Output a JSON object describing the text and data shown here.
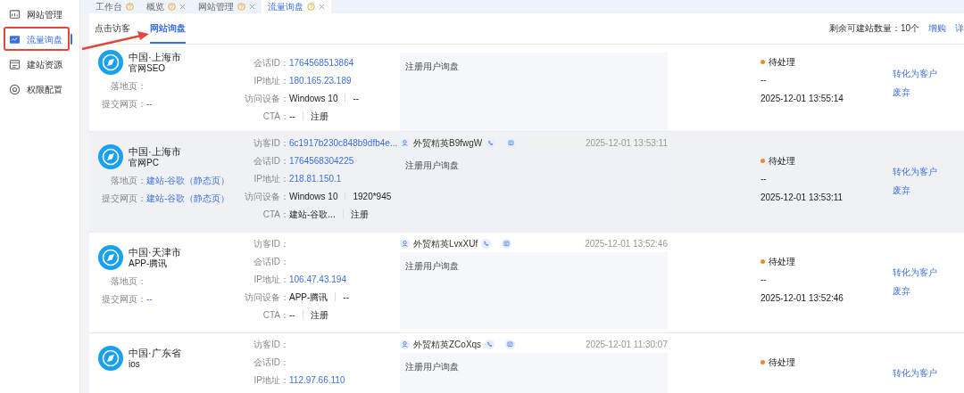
{
  "sidebar": {
    "items": [
      {
        "label": "网站管理",
        "selected": false
      },
      {
        "label": "流量询盘",
        "selected": true
      },
      {
        "label": "建站资源",
        "selected": false
      },
      {
        "label": "权限配置",
        "selected": false
      }
    ]
  },
  "tabs": [
    {
      "label": "工作台",
      "closable": false,
      "selected": false
    },
    {
      "label": "概览",
      "closable": true,
      "selected": false
    },
    {
      "label": "网站管理",
      "closable": true,
      "selected": false
    },
    {
      "label": "流量询盘",
      "closable": true,
      "selected": true
    }
  ],
  "subtabs": [
    {
      "label": "点击访客",
      "selected": false
    },
    {
      "label": "网站询盘",
      "selected": true
    }
  ],
  "quota": {
    "label": "剩余可建站数量：",
    "value": "10个",
    "links": [
      "增购",
      "详"
    ]
  },
  "rows": [
    {
      "highlighted": false,
      "location": "中国·上海市",
      "channel": "官网SEO",
      "landing": {
        "label": "落地页："
      },
      "submit": {
        "label": "提交网页：",
        "value": "--"
      },
      "info": [
        {
          "label": "会话ID：",
          "values": [
            "1764568513864"
          ],
          "link": true
        },
        {
          "label": "IP地址：",
          "values": [
            "180.165.23.189"
          ],
          "link": true
        },
        {
          "label": "访问设备：",
          "values": [
            "Windows 10",
            "--"
          ],
          "link": false
        },
        {
          "label": "CTA：",
          "values": [
            "--",
            "注册"
          ],
          "link": false
        }
      ],
      "message": "注册用户询盘",
      "status": {
        "label": "待处理",
        "color": "#f0892e"
      },
      "handler": "--",
      "handled_at": "2025-12-01 13:55:14",
      "actions": [
        "转化为客户",
        "废弃"
      ]
    },
    {
      "highlighted": true,
      "location": "中国·上海市",
      "channel": "官网PC",
      "landing": {
        "label": "落地页：",
        "value": "建站-谷歌（静态页）"
      },
      "submit": {
        "label": "提交网页：",
        "value": "建站-谷歌（静态页）"
      },
      "info": [
        {
          "label": "访客ID：",
          "values": [
            "6c1917b230c848b9dfb4e..."
          ],
          "link": true
        },
        {
          "label": "会话ID：",
          "values": [
            "1764568304225"
          ],
          "link": true
        },
        {
          "label": "IP地址：",
          "values": [
            "218.81.150.1"
          ],
          "link": true
        },
        {
          "label": "访问设备：",
          "values": [
            "Windows 10",
            "1920*945"
          ],
          "link": false
        },
        {
          "label": "CTA：",
          "values": [
            "建站-谷歌...",
            "注册"
          ],
          "link": false
        }
      ],
      "agent": "外贸精英B9fwgW",
      "time": "2025-12-01 13:53:11",
      "message": "注册用户询盘",
      "status": {
        "label": "待处理",
        "color": "#f0892e"
      },
      "handler": "--",
      "handled_at": "2025-12-01 13:53:11",
      "actions": [
        "转化为客户",
        "废弃"
      ]
    },
    {
      "highlighted": false,
      "location": "中国·天津市",
      "channel": "APP-腾讯",
      "landing": {
        "label": "落地页："
      },
      "submit": {
        "label": "提交网页：",
        "value": "--"
      },
      "info": [
        {
          "label": "访客ID："
        },
        {
          "label": "会话ID："
        },
        {
          "label": "IP地址：",
          "values": [
            "106.47.43.194"
          ],
          "link": true
        },
        {
          "label": "访问设备：",
          "values": [
            "APP-腾讯",
            "--"
          ],
          "link": false
        },
        {
          "label": "CTA：",
          "values": [
            "--",
            "注册"
          ],
          "link": false
        }
      ],
      "agent": "外贸精英LvxXUf",
      "time": "2025-12-01 13:52:46",
      "message": "注册用户询盘",
      "status": {
        "label": "待处理",
        "color": "#f0892e"
      },
      "handler": "--",
      "handled_at": "2025-12-01 13:52:46",
      "actions": [
        "转化为客户",
        "废弃"
      ]
    },
    {
      "highlighted": false,
      "location": "中国·广东省",
      "channel": "ios",
      "info": [
        {
          "label": "访客ID："
        },
        {
          "label": "会话ID："
        },
        {
          "label": "IP地址：",
          "values": [
            "112.97.66.110"
          ],
          "link": true
        }
      ],
      "agent": "外贸精英ZCoXqs",
      "time": "2025-12-01 11:30:07",
      "message": "注册用户询盘",
      "status": {
        "label": "待处理",
        "color": "#f0892e"
      },
      "actions": [
        "转化为客户"
      ]
    }
  ]
}
